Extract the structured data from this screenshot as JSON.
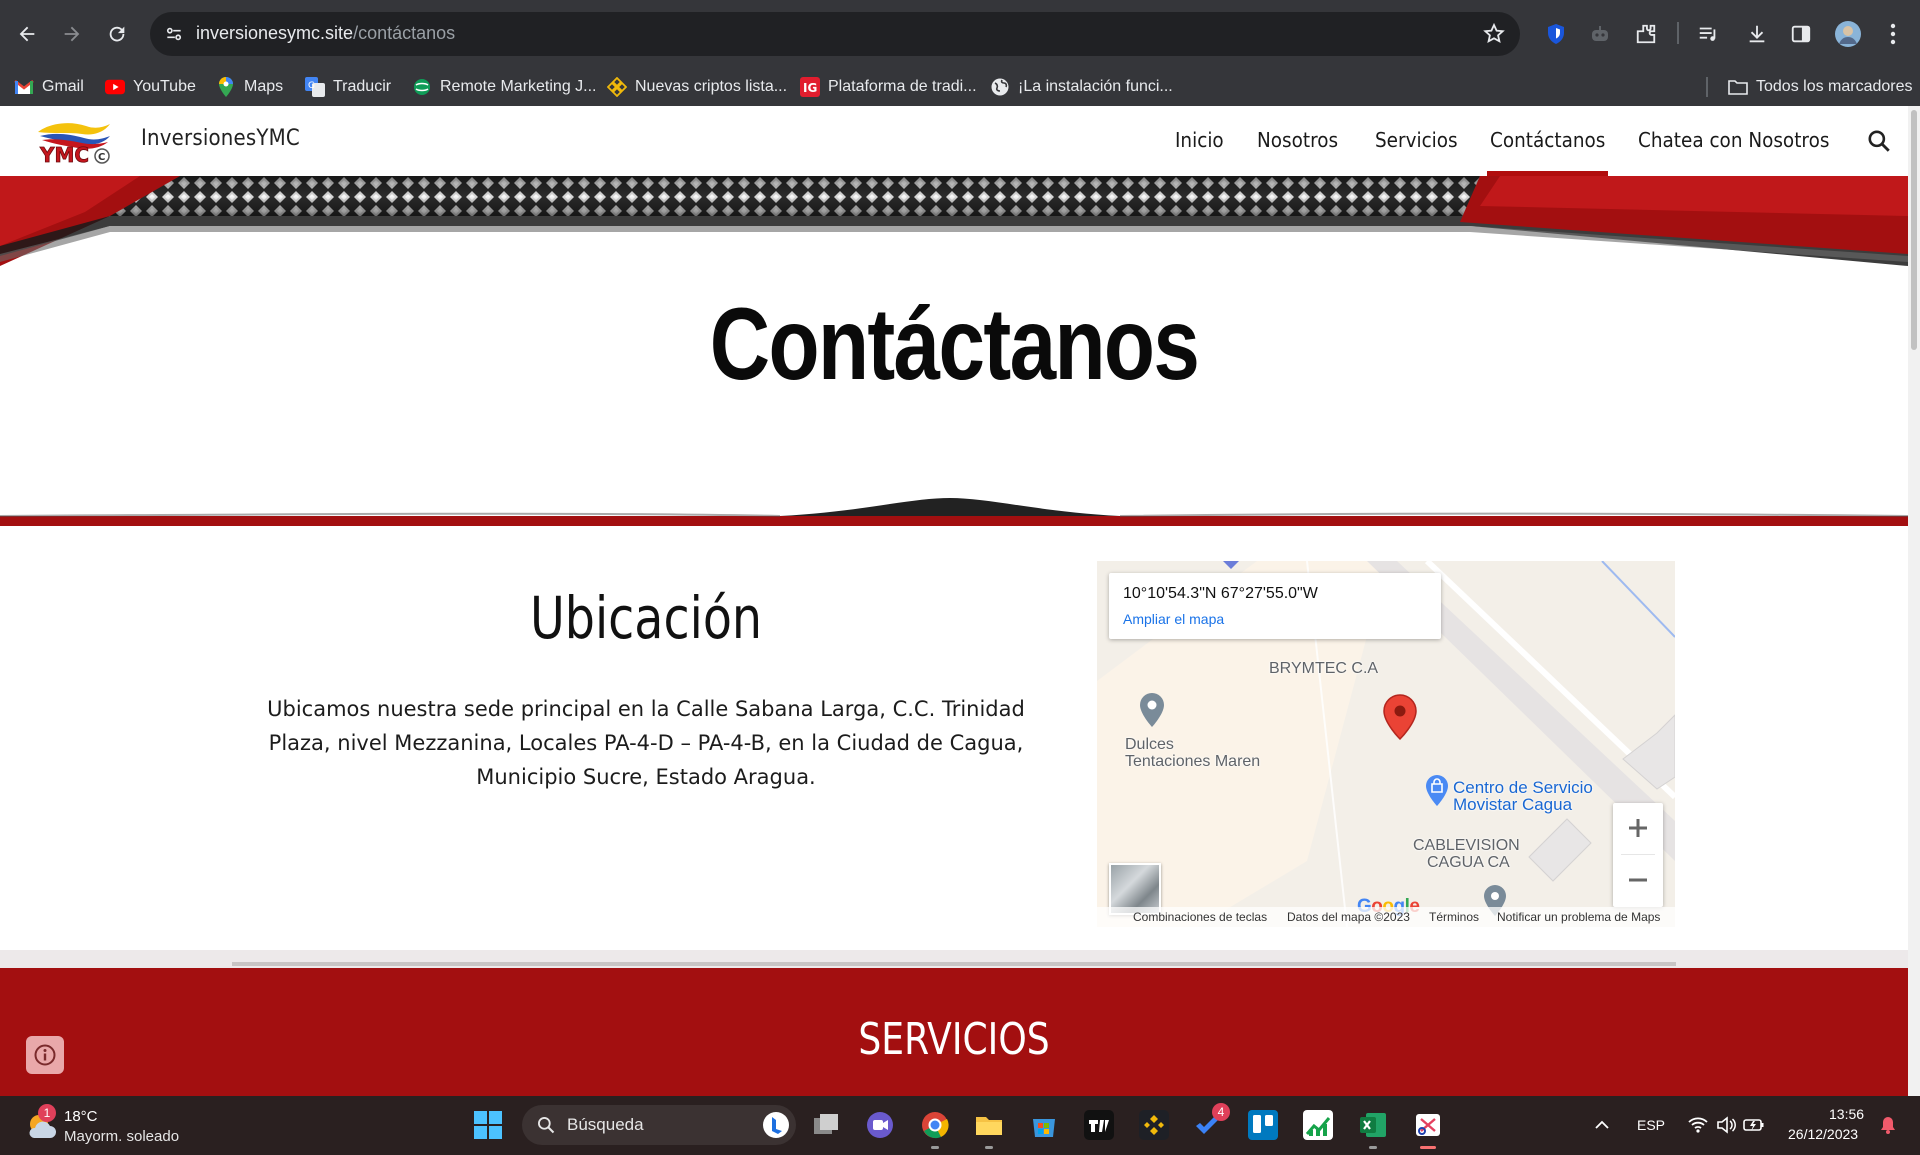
{
  "browser": {
    "url_host": "inversionesymc.site",
    "url_path": "/contáctanos",
    "bookmarks": [
      {
        "label": "Gmail",
        "icon": "gmail-icon"
      },
      {
        "label": "YouTube",
        "icon": "youtube-icon"
      },
      {
        "label": "Maps",
        "icon": "maps-icon"
      },
      {
        "label": "Traducir",
        "icon": "translate-icon"
      },
      {
        "label": "Remote Marketing J...",
        "icon": "remote-marketing-icon"
      },
      {
        "label": "Nuevas criptos lista...",
        "icon": "binance-icon"
      },
      {
        "label": "Plataforma de tradi...",
        "icon": "ig-icon"
      },
      {
        "label": "¡La instalación funci...",
        "icon": "globe-icon"
      }
    ],
    "all_bookmarks_label": "Todos los marcadores"
  },
  "site": {
    "title": "InversionesYMC",
    "nav": [
      {
        "label": "Inicio",
        "active": false
      },
      {
        "label": "Nosotros",
        "active": false
      },
      {
        "label": "Servicios",
        "active": false
      },
      {
        "label": "Contáctanos",
        "active": true
      },
      {
        "label": "Chatea con Nosotros",
        "active": false
      }
    ],
    "accent_color": "#b10d0d"
  },
  "hero": {
    "title": "Contáctanos"
  },
  "location": {
    "heading": "Ubicación",
    "text": "Ubicamos nuestra sede principal en la Calle Sabana Larga, C.C. Trinidad Plaza, nivel Mezzanina, Locales PA-4-D – PA-4-B, en la Ciudad de Cagua, Municipio Sucre, Estado Aragua."
  },
  "map": {
    "coords": "10°10'54.3\"N 67°27'55.0\"W",
    "enlarge_link": "Ampliar el mapa",
    "labels": {
      "brymtec": "BRYMTEC C.A",
      "dulces_1": "Dulces",
      "dulces_2": "Tentaciones Maren",
      "movistar_1": "Centro de Servicio",
      "movistar_2": "Movistar Cagua",
      "cablevision_1": "CABLEVISION",
      "cablevision_2": "CAGUA CA"
    },
    "zoom_in": "+",
    "zoom_out": "−",
    "google": "Google",
    "footer": {
      "shortcuts": "Combinaciones de teclas",
      "map_data": "Datos del mapa ©2023",
      "terms": "Términos",
      "report": "Notificar un problema de Maps"
    }
  },
  "services": {
    "heading": "SERVICIOS"
  },
  "taskbar": {
    "weather_badge": "1",
    "temperature": "18°C",
    "weather_desc": "Mayorm. soleado",
    "search_placeholder": "Búsqueda",
    "todo_badge": "4",
    "language": "ESP",
    "time": "13:56",
    "date": "26/12/2023"
  }
}
